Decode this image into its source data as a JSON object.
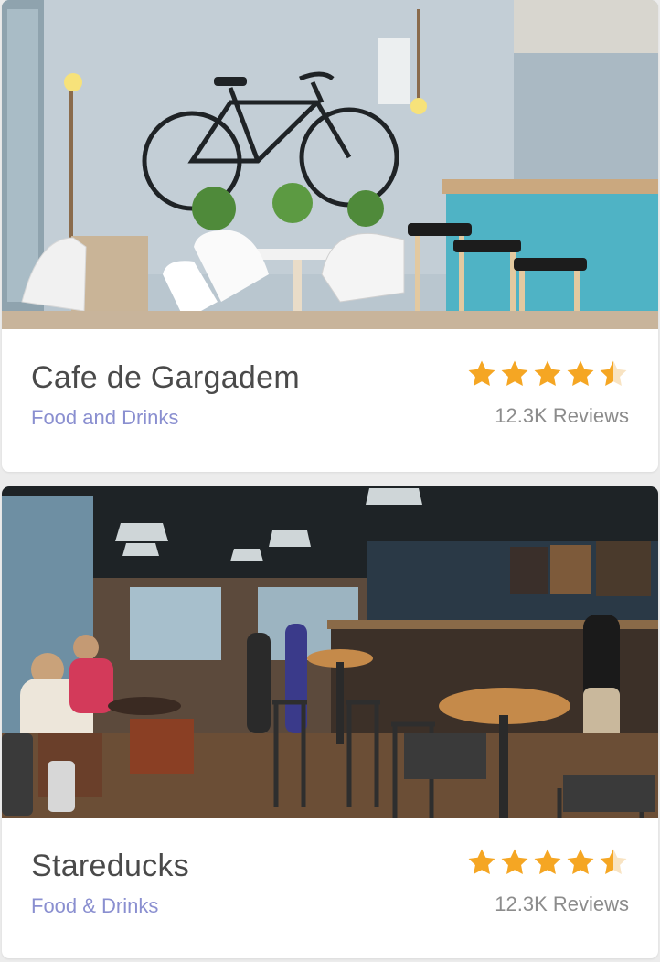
{
  "places": [
    {
      "name": "Cafe de Gargadem",
      "category": "Food and Drinks",
      "rating": 4.5,
      "reviews": "12.3K Reviews"
    },
    {
      "name": "Stareducks",
      "category": "Food & Drinks",
      "rating": 4.5,
      "reviews": "12.3K Reviews"
    }
  ],
  "colors": {
    "star_filled": "#f5a623",
    "star_empty": "#f8e3c2",
    "title": "#4a4a4a",
    "category": "#8a8fd0",
    "reviews": "#8c8c8c"
  }
}
